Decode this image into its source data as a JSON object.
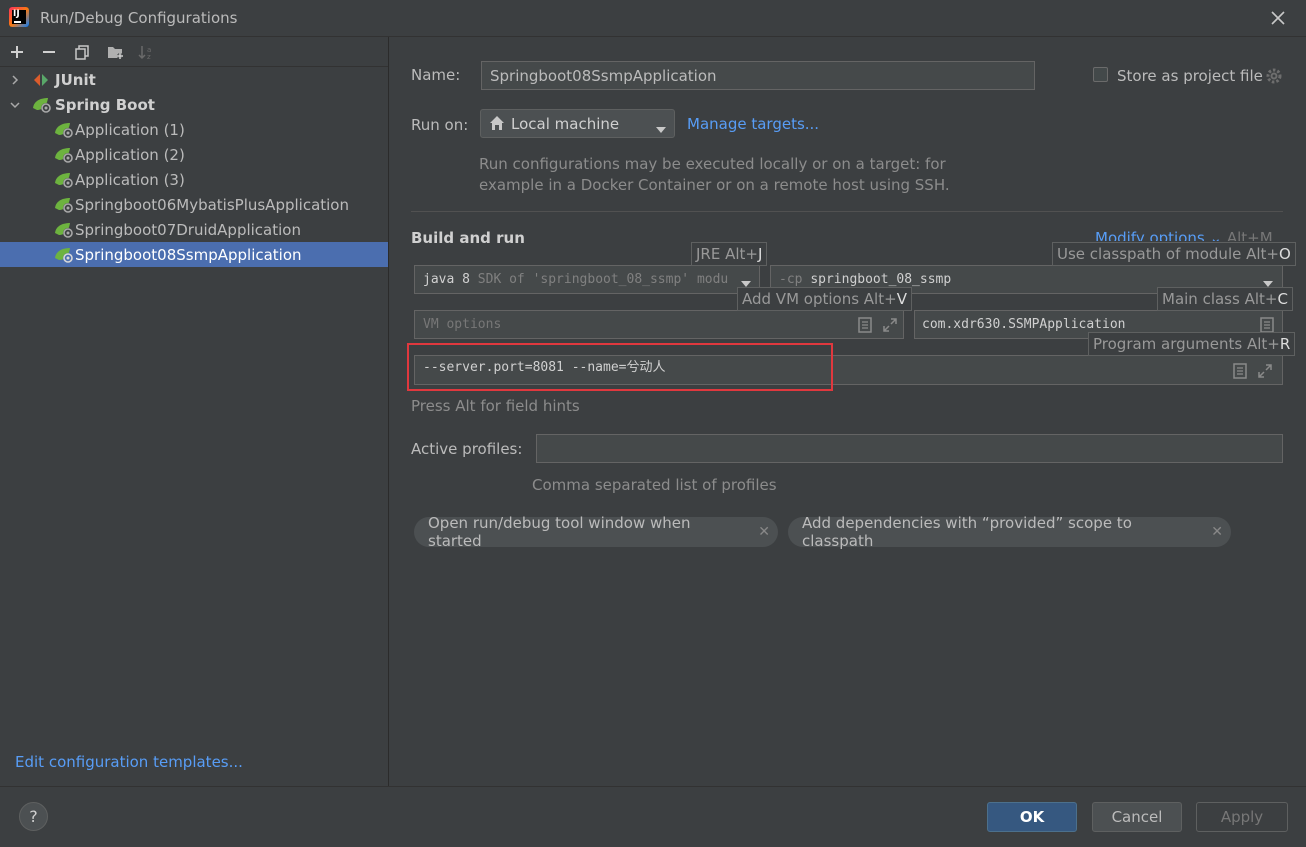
{
  "window": {
    "title": "Run/Debug Configurations"
  },
  "tree": {
    "junit": "JUnit",
    "spring_boot": "Spring Boot",
    "items": [
      "Application (1)",
      "Application (2)",
      "Application (3)",
      "Springboot06MybatisPlusApplication",
      "Springboot07DruidApplication",
      "Springboot08SsmpApplication"
    ],
    "edit_templates": "Edit configuration templates..."
  },
  "form": {
    "name_label": "Name:",
    "name_value": "Springboot08SsmpApplication",
    "store_label": "Store as project file",
    "run_on_label": "Run on:",
    "run_on_value": "Local machine",
    "manage_targets": "Manage targets...",
    "run_on_desc_1": "Run configurations may be executed locally or on a target: for",
    "run_on_desc_2": "example in a Docker Container or on a remote host using SSH.",
    "build_and_run": "Build and run",
    "modify_options": "Modify options",
    "modify_shortcut": "Alt+M",
    "jre_hint_label": "JRE Alt+",
    "jre_hint_key": "J",
    "classpath_hint_label": "Use classpath of module Alt+",
    "classpath_hint_key": "O",
    "jre_value_a": "java 8",
    "jre_value_b": " SDK of 'springboot_08_ssmp' modu",
    "cp_prefix": "-cp ",
    "cp_value": "springboot_08_ssmp",
    "vm_hint_label": "Add VM options Alt+",
    "vm_hint_key": "V",
    "main_hint_label": "Main class Alt+",
    "main_hint_key": "C",
    "vm_placeholder": "VM options",
    "main_class": "com.xdr630.SSMPApplication",
    "args_hint_label": "Program arguments Alt+",
    "args_hint_key": "R",
    "program_args": "--server.port=8081 --name=兮动人",
    "alt_hint": "Press Alt for field hints",
    "profiles_label": "Active profiles:",
    "profiles_desc": "Comma separated list of profiles",
    "chip_1": "Open run/debug tool window when started",
    "chip_2": "Add dependencies with “provided” scope to classpath"
  },
  "buttons": {
    "ok": "OK",
    "cancel": "Cancel",
    "apply": "Apply",
    "help": "?"
  },
  "colors": {
    "accent": "#589df6",
    "selection": "#4b6eaf",
    "highlight": "#e0383e",
    "spring": "#6db33f"
  }
}
